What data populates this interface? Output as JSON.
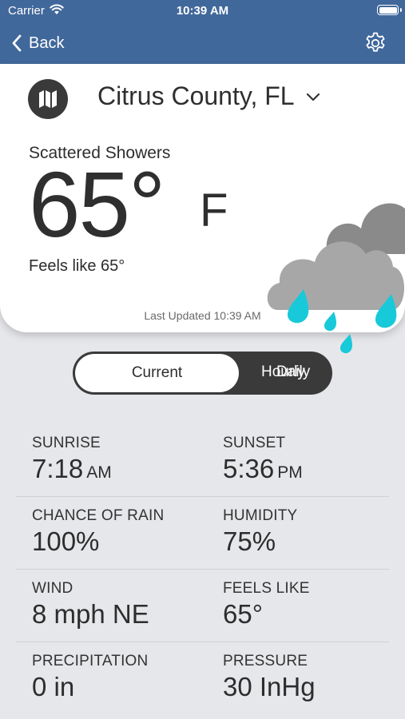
{
  "status_bar": {
    "carrier": "Carrier",
    "time": "10:39 AM"
  },
  "nav": {
    "back_label": "Back",
    "settings_icon": "gear-icon",
    "accent_color": "#41689b"
  },
  "location": {
    "name": "Citrus County, FL",
    "map_icon": "map-icon",
    "dropdown_icon": "chevron-down-icon"
  },
  "current": {
    "condition": "Scattered Showers",
    "temperature": "65°",
    "unit": "F",
    "feels_like_text": "Feels like 65°",
    "icon": "cloud-rain-icon",
    "last_updated": "Last Updated 10:39 AM"
  },
  "tabs": [
    {
      "label": "Current",
      "selected": true
    },
    {
      "label": "Hourly",
      "selected": false
    },
    {
      "label": "Daily",
      "selected": false
    }
  ],
  "details": [
    {
      "left_label": "SUNRISE",
      "left_value": "7:18",
      "left_suffix": "AM",
      "right_label": "SUNSET",
      "right_value": "5:36",
      "right_suffix": "PM"
    },
    {
      "left_label": "CHANCE OF RAIN",
      "left_value": "100%",
      "right_label": "HUMIDITY",
      "right_value": "75%"
    },
    {
      "left_label": "WIND",
      "left_value": "8 mph NE",
      "right_label": "FEELS LIKE",
      "right_value": "65°"
    },
    {
      "left_label": "PRECIPITATION",
      "left_value": "0 in",
      "right_label": "PRESSURE",
      "right_value": "30 InHg"
    }
  ]
}
